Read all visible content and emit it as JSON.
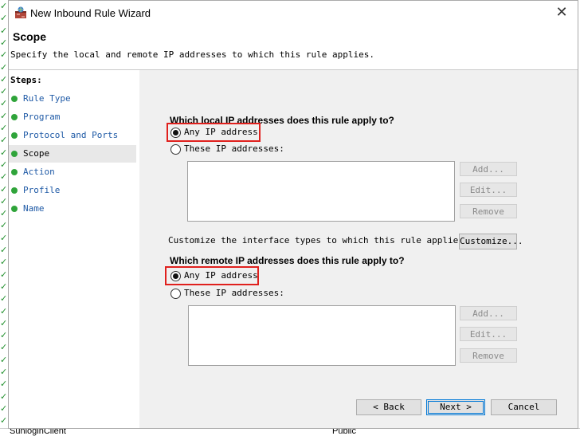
{
  "window": {
    "title": "New Inbound Rule Wizard",
    "icon": "firewall-rule-icon",
    "close_glyph": "✕"
  },
  "header": {
    "title": "Scope",
    "description": "Specify the local and remote IP addresses to which this rule applies."
  },
  "steps": {
    "title": "Steps:",
    "items": [
      {
        "label": "Rule Type"
      },
      {
        "label": "Program"
      },
      {
        "label": "Protocol and Ports"
      },
      {
        "label": "Scope",
        "active": true
      },
      {
        "label": "Action"
      },
      {
        "label": "Profile"
      },
      {
        "label": "Name"
      }
    ]
  },
  "local": {
    "question": "Which local IP addresses does this rule apply to?",
    "any_label": "Any IP address",
    "these_label": "These IP addresses:",
    "selected": "any",
    "add": "Add...",
    "edit": "Edit...",
    "remove": "Remove"
  },
  "interface": {
    "label": "Customize the interface types to which this rule applies:",
    "button": "Customize..."
  },
  "remote": {
    "question": "Which remote IP addresses does this rule apply to?",
    "any_label": "Any IP address",
    "these_label": "These IP addresses:",
    "selected": "any",
    "add": "Add...",
    "edit": "Edit...",
    "remove": "Remove"
  },
  "footer": {
    "back": "< Back",
    "next": "Next >",
    "cancel": "Cancel"
  },
  "background": {
    "row_text": "SunloginClient",
    "row_value": "Public"
  },
  "colors": {
    "highlight": "#e0201d",
    "link": "#1f5aa6",
    "step_dot": "#2fa43a"
  }
}
